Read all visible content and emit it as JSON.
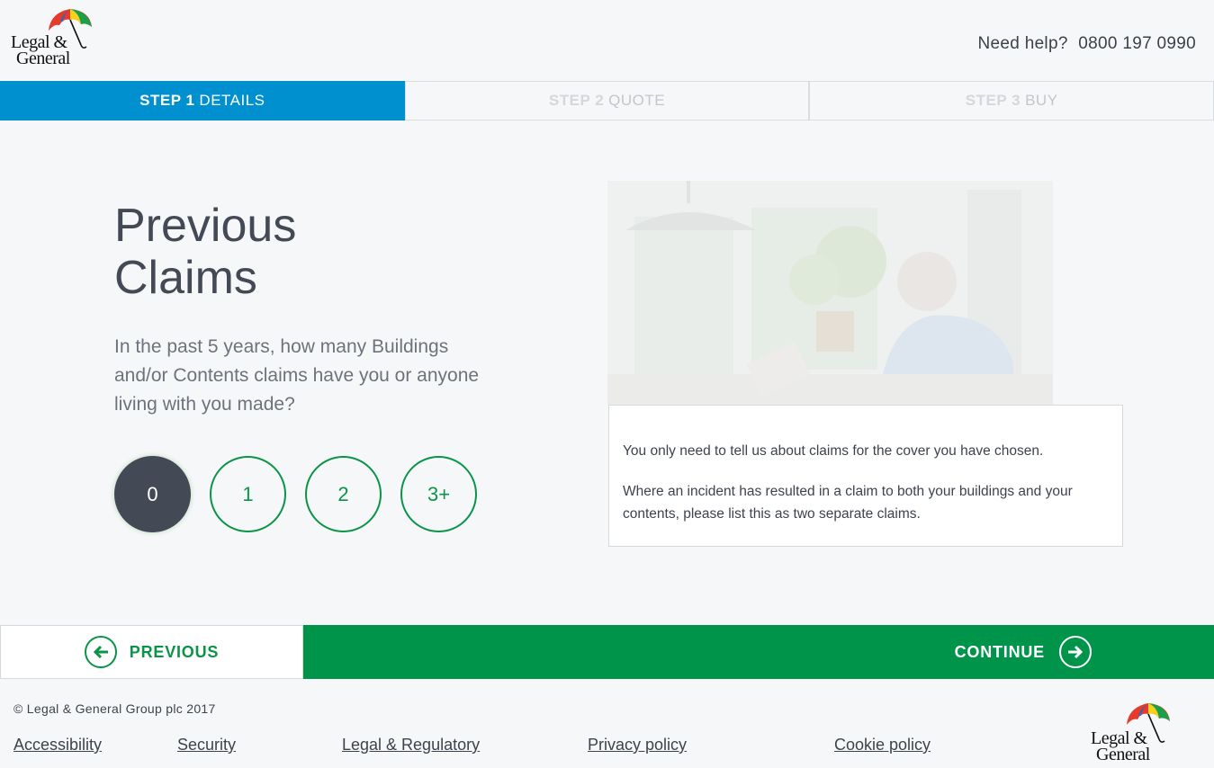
{
  "header": {
    "logo_text_line1": "Legal &",
    "logo_text_line2": "General",
    "help_label": "Need help?",
    "help_phone": "0800 197 0990"
  },
  "steps": [
    {
      "num": "STEP 1",
      "label": "DETAILS",
      "active": true
    },
    {
      "num": "STEP 2",
      "label": "QUOTE",
      "active": false
    },
    {
      "num": "STEP 3",
      "label": "BUY",
      "active": false
    }
  ],
  "main": {
    "title_line1": "Previous",
    "title_line2": "Claims",
    "question": "In the past 5 years, how many Buildings and/or Contents claims have you or anyone living with you made?",
    "options": [
      "0",
      "1",
      "2",
      "3+"
    ],
    "selected_option": "0",
    "info_p1": "You only need to tell us about claims for the cover you have chosen.",
    "info_p2": "Where an incident has resulted in a claim to both your buildings and your contents, please list this as two separate claims."
  },
  "nav": {
    "previous_label": "PREVIOUS",
    "continue_label": "CONTINUE"
  },
  "footer": {
    "copyright": "© Legal & General Group plc 2017",
    "links": [
      "Accessibility",
      "Security",
      "Legal & Regulatory",
      "Privacy policy",
      "Cookie policy"
    ]
  },
  "colors": {
    "step_active": "#0090d0",
    "brand_green": "#00944a",
    "selected_option": "#434a56"
  }
}
